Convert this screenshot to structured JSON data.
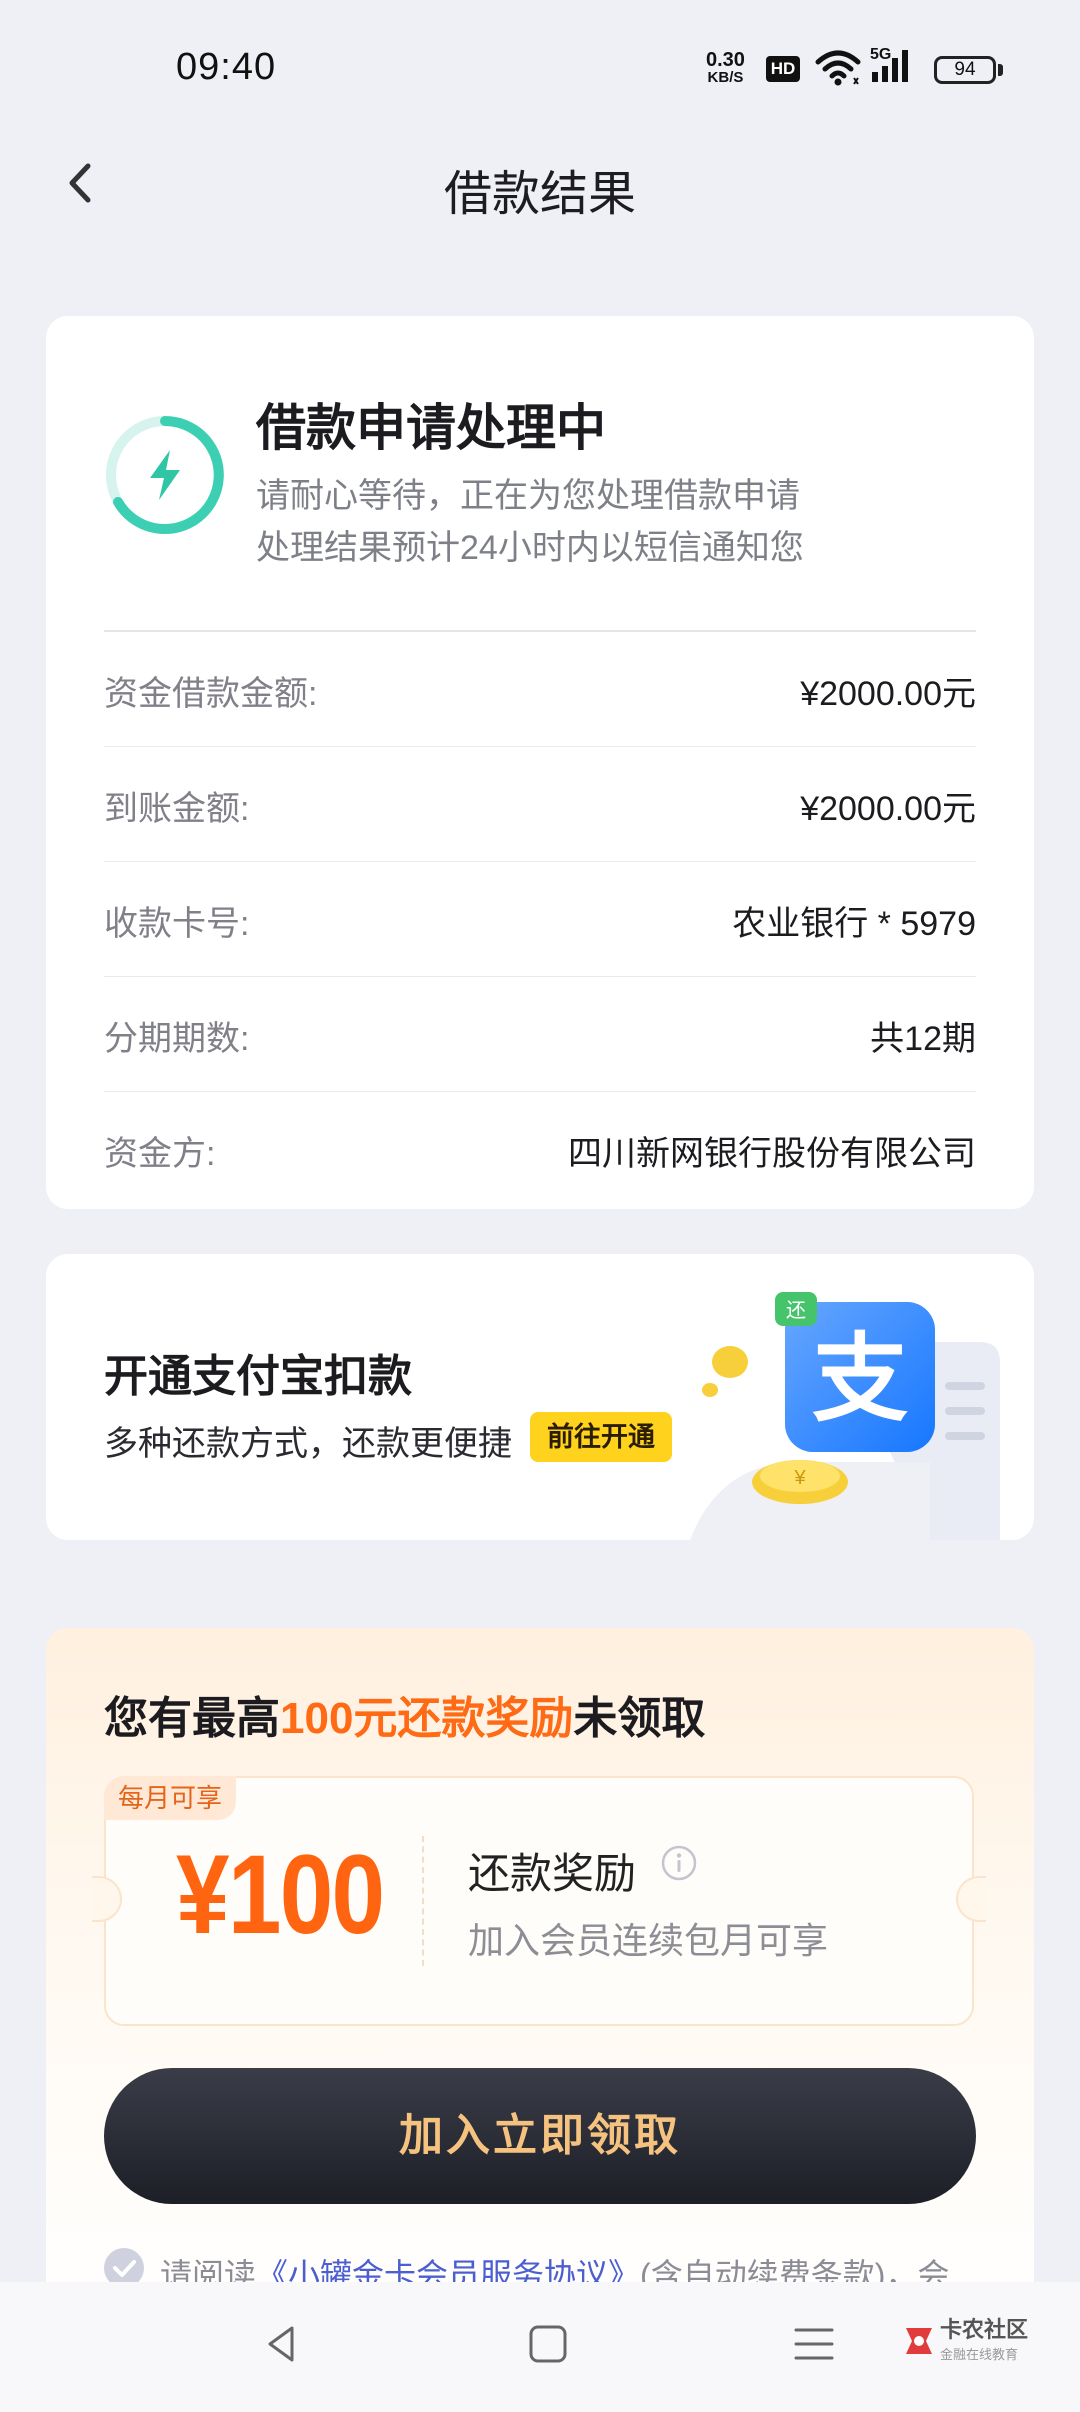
{
  "status_bar": {
    "time": "09:40",
    "net_speed_value": "0.30",
    "net_speed_unit": "KB/S",
    "hd_badge": "HD",
    "signal_label": "5G",
    "battery": "94"
  },
  "header": {
    "title": "借款结果"
  },
  "status_card": {
    "title": "借款申请处理中",
    "desc_line1": "请耐心等待，正在为您处理借款申请",
    "desc_line2": "处理结果预计24小时内以短信通知您",
    "accent_color": "#3ccfb4",
    "rows": [
      {
        "label": "资金借款金额:",
        "value": "¥2000.00元"
      },
      {
        "label": "到账金额:",
        "value": "¥2000.00元"
      },
      {
        "label": "收款卡号:",
        "value": "农业银行 * 5979"
      },
      {
        "label": "分期期数:",
        "value": "共12期"
      },
      {
        "label": "资金方:",
        "value": "四川新网银行股份有限公司"
      }
    ]
  },
  "alipay_card": {
    "title": "开通支付宝扣款",
    "desc": "多种还款方式，还款更便捷",
    "button": "前往开通",
    "logo_char": "支",
    "tag_char": "还",
    "coin_char": "¥"
  },
  "reward_card": {
    "headline_pre": "您有最高",
    "headline_highlight": "100元还款奖励",
    "headline_post": "未领取",
    "tag": "每月可享",
    "amount": "¥100",
    "reward_title": "还款奖励",
    "reward_sub": "加入会员连续包月可享",
    "claim_button": "加入立即领取",
    "agreement_pre": "请阅读",
    "agreement_link": "《小罐金卡会员服务协议》",
    "agreement_post": "(含自动续费条款)，会",
    "highlight_color": "#ff6a14"
  },
  "watermark": {
    "name": "卡农社区",
    "sub": "金融在线教育"
  }
}
